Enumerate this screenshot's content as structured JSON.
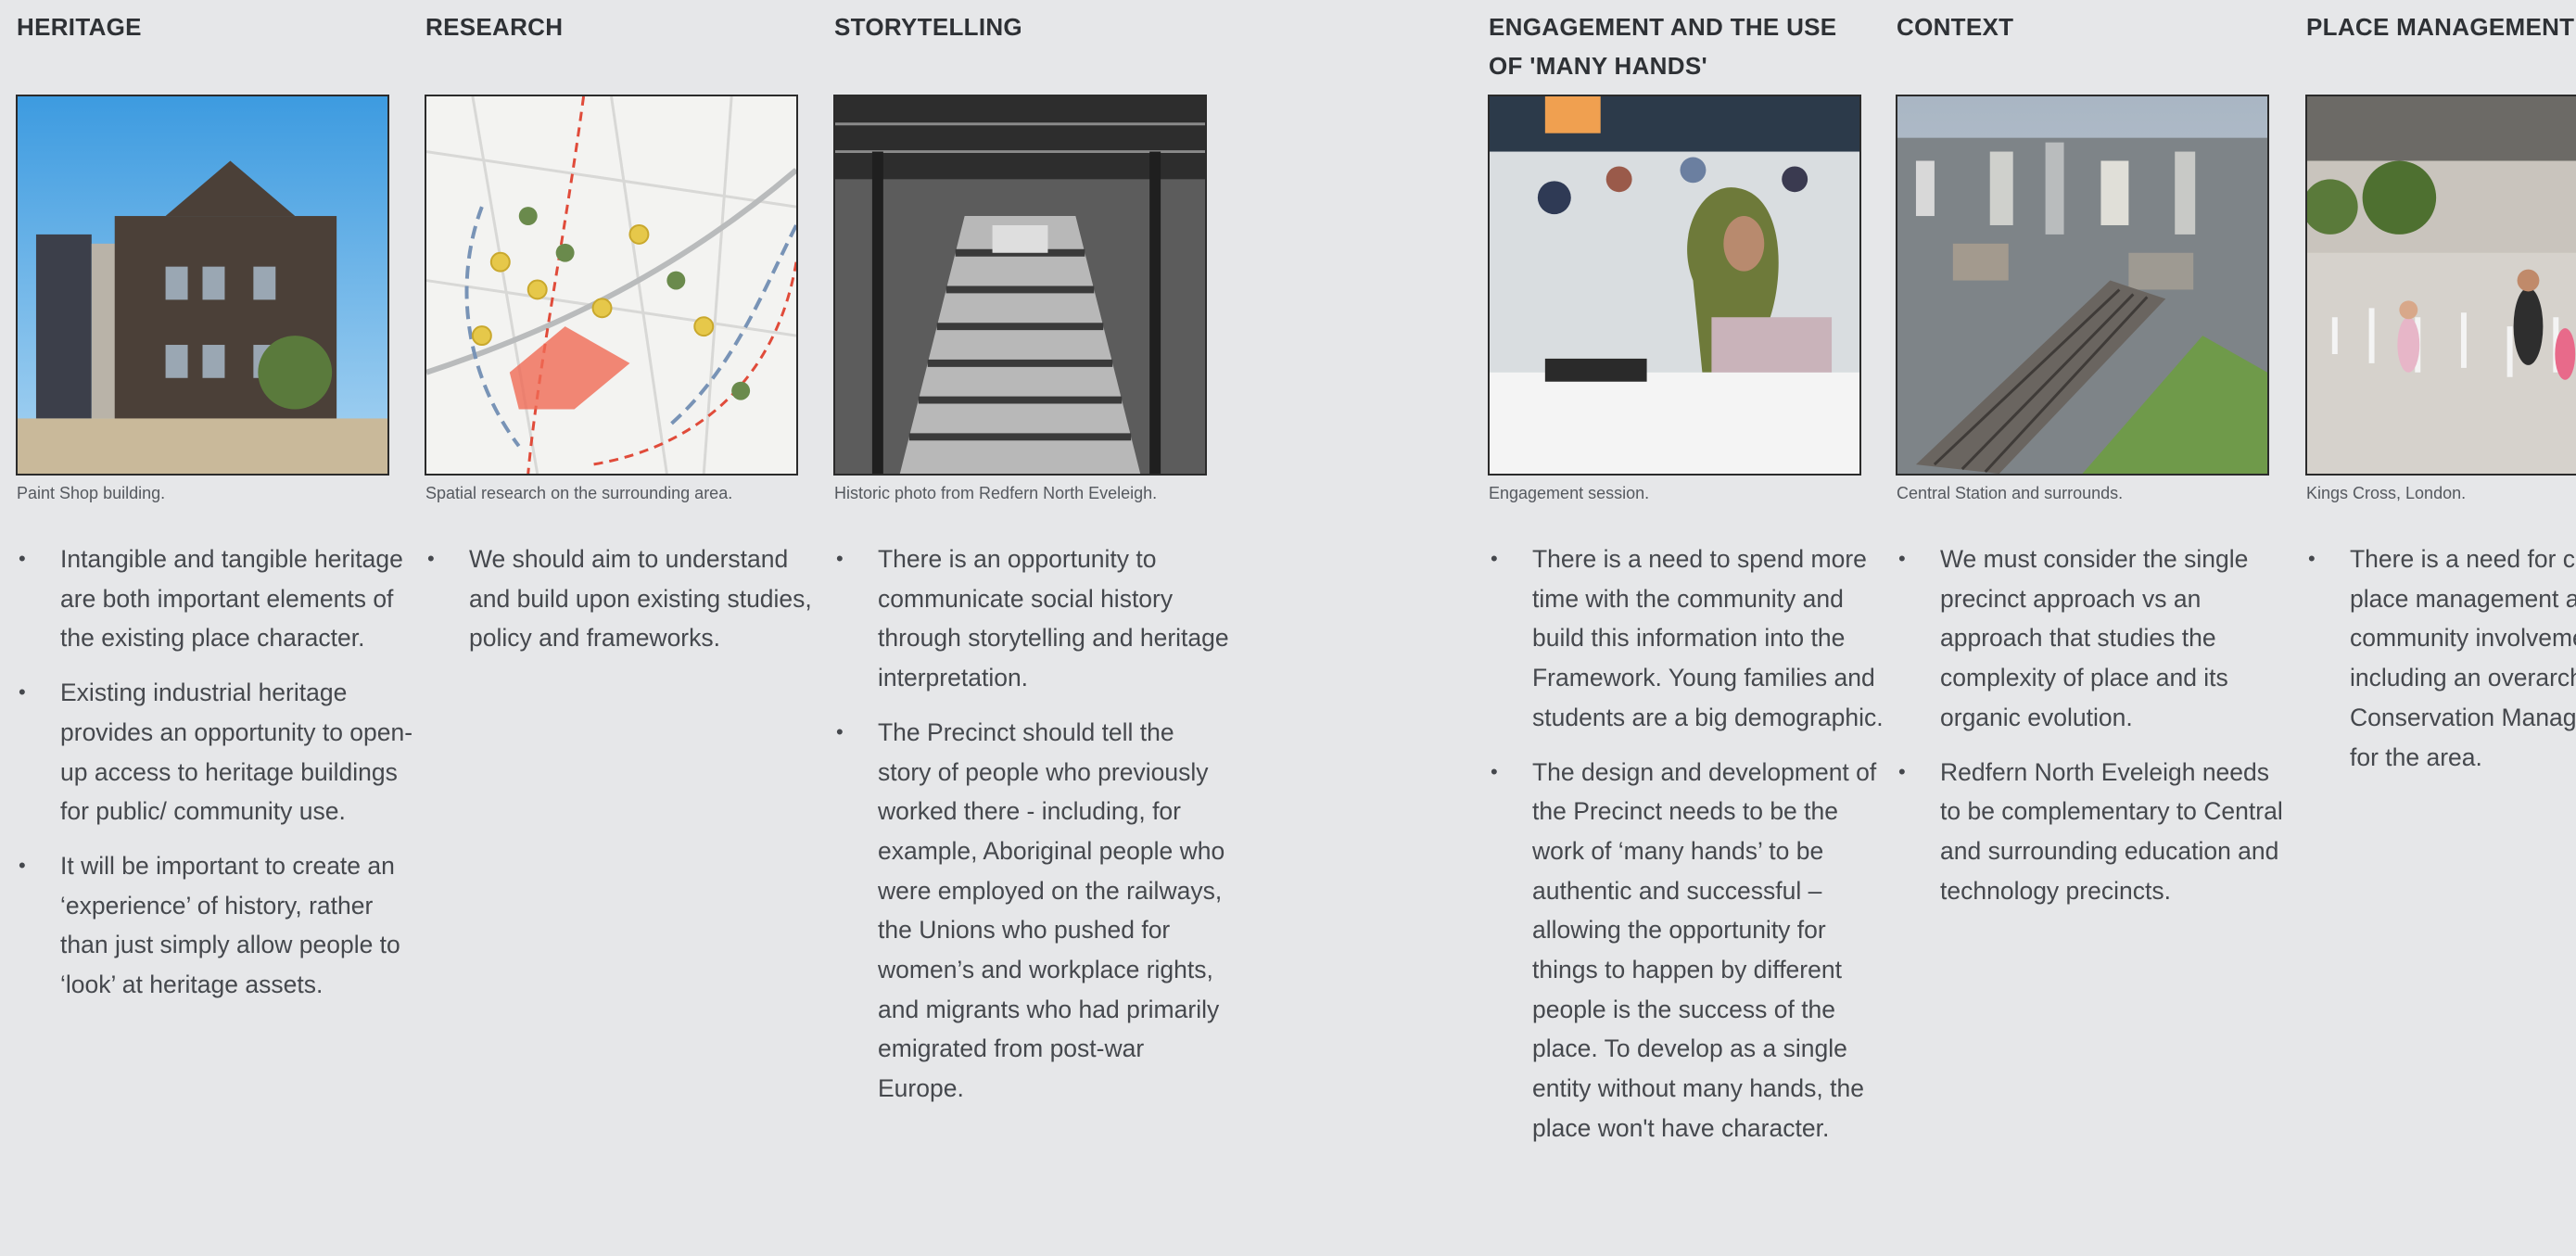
{
  "columns": [
    {
      "heading": "HERITAGE",
      "caption": "Paint Shop building.",
      "bullets": [
        "Intangible and tangible heritage are both important elements of the existing place character.",
        "Existing industrial heritage provides an opportunity to open-up access to heritage buildings for public/ community use.",
        "It will be important to create an ‘experience’ of history, rather than just simply allow people to ‘look’ at heritage assets."
      ]
    },
    {
      "heading": "RESEARCH",
      "caption": "Spatial research on the surrounding area.",
      "bullets": [
        "We should aim to understand and build upon existing studies, policy and frameworks."
      ]
    },
    {
      "heading": "STORYTELLING",
      "caption": "Historic photo from Redfern North Eveleigh.",
      "bullets": [
        "There is an opportunity to communicate social history through storytelling and heritage interpretation.",
        "The Precinct should tell the story of people who previously worked there - including, for example, Aboriginal people who were employed on the railways, the Unions who pushed for women’s and workplace rights, and migrants who had primarily emigrated from post-war Europe."
      ]
    },
    {
      "heading": "ENGAGEMENT AND THE USE OF 'MANY HANDS'",
      "caption": "Engagement session.",
      "bullets": [
        "There is a need to spend more time with the community and build this information into the Framework. Young families and students are a big demographic.",
        "The design and development of the Precinct needs to be the work of ‘many hands’ to be authentic and successful –allowing the opportunity for things to happen by different people is the success of the place. To develop as a single entity without many hands, the place won't have character."
      ]
    },
    {
      "heading": "CONTEXT",
      "caption": "Central Station and surrounds.",
      "bullets": [
        "We must consider the single precinct approach vs an approach that studies the complexity of place and its organic evolution.",
        "Redfern North Eveleigh needs to be complementary to Central and surrounding education and technology precincts."
      ]
    },
    {
      "heading": "PLACE MANAGEMENT",
      "caption": "Kings Cross, London.",
      "bullets": [
        "There is a need for community place management and community involvement, including an overarching Conservation Management Plan for the area."
      ]
    }
  ],
  "icons": {
    "bullet": "bullet-dot"
  }
}
